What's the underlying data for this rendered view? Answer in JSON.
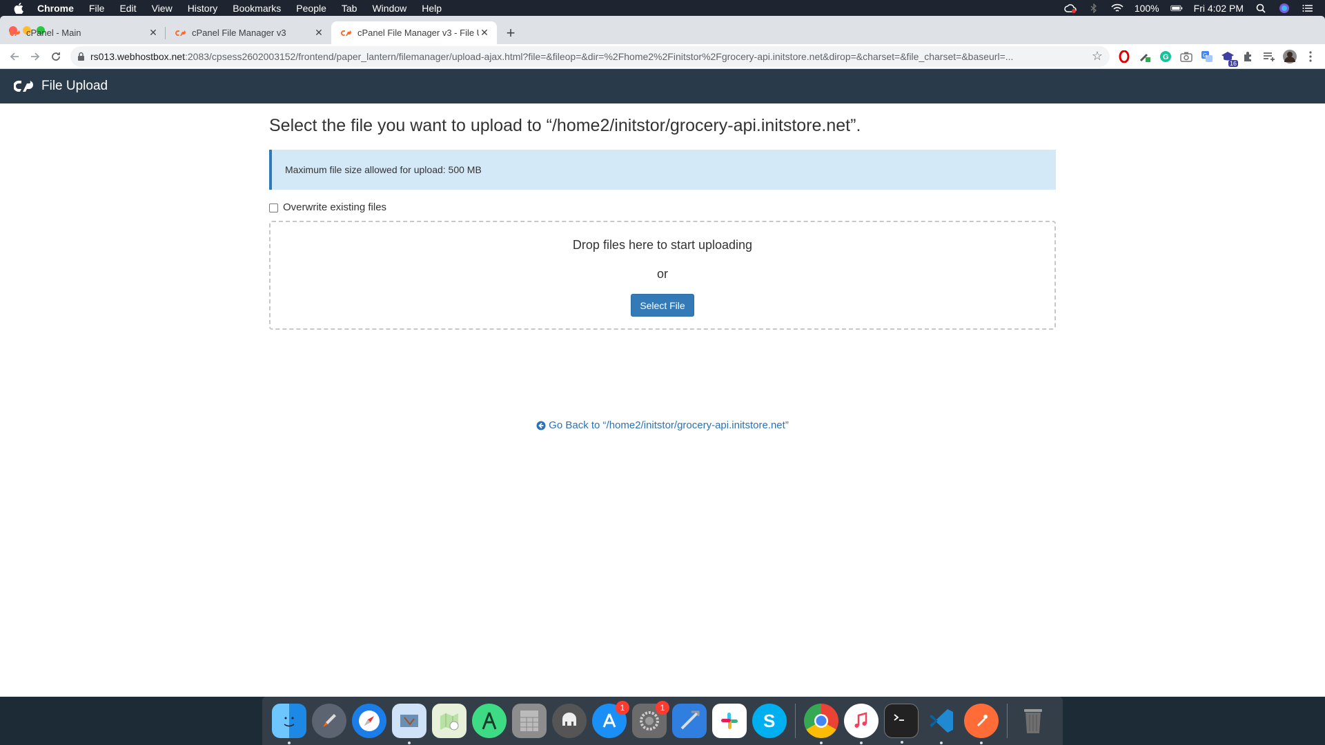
{
  "menubar": {
    "app": "Chrome",
    "items": [
      "File",
      "Edit",
      "View",
      "History",
      "Bookmarks",
      "People",
      "Tab",
      "Window",
      "Help"
    ],
    "battery": "100%",
    "clock": "Fri 4:02 PM"
  },
  "tabs": [
    {
      "title": "cPanel - Main"
    },
    {
      "title": "cPanel File Manager v3"
    },
    {
      "title": "cPanel File Manager v3 - File U"
    }
  ],
  "address": {
    "host": "rs013.webhostbox.net",
    "path": ":2083/cpsess2602003152/frontend/paper_lantern/filemanager/upload-ajax.html?file=&fileop=&dir=%2Fhome2%2Finitstor%2Fgrocery-api.initstore.net&dirop=&charset=&file_charset=&baseurl=..."
  },
  "extensions": {
    "badge_count": "16"
  },
  "header": {
    "title": "File Upload"
  },
  "page": {
    "heading": "Select the file you want to upload to “/home2/initstor/grocery-api.initstore.net”.",
    "alert": "Maximum file size allowed for upload: 500 MB",
    "overwrite_label": "Overwrite existing files",
    "drop_text": "Drop files here to start uploading",
    "or_text": "or",
    "select_button": "Select File",
    "go_back": "Go Back to “/home2/initstor/grocery-api.initstore.net”"
  },
  "dock": {
    "appstore_badge": "1",
    "settings_badge": "1"
  }
}
